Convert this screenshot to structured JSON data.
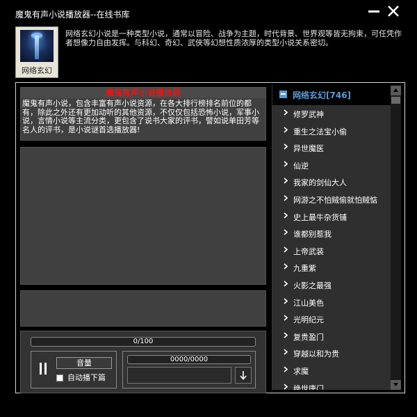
{
  "window": {
    "title": "魔鬼有声小说播放器--在线书库"
  },
  "header": {
    "category_caption": "网络玄幻",
    "description": "网络玄幻小说是一种类型小说，通常以冒险、战争为主题，时代背景、世界观等皆无拘束，可任凭作者想像力自由发挥。与科幻、奇幻、武侠等幻想性质浓厚的类型小说关系密切。"
  },
  "announcement": {
    "title": "魔鬼有声小说播放器",
    "text": "魔鬼有声小说，包含丰富有声小说资源，在各大排行榜排名前位的都有，除此之外还有更加动听的其他资源，不仅仅包括恐怖小说，军事小说，言情小说等主流分类，更包含了说书大家的评书，譬如说单田芳等名人的评书，是小说谜首选播放器!"
  },
  "controls": {
    "main_progress": {
      "value": 0,
      "max": 100,
      "text": "0/100"
    },
    "volume_label": "音量",
    "auto_next_label": "自动播下篇",
    "auto_next_checked": false,
    "download_progress_text": "0000/0000"
  },
  "tree": {
    "root": {
      "label": "网络玄幻",
      "count": "[746]"
    },
    "items": [
      "修罗武神",
      "重生之法宝小偷",
      "异世魔医",
      "仙逆",
      "我家的剑仙大人",
      "网游之不怕贼偷就怕贼惦",
      "史上最牛杂货铺",
      "谁都别惹我",
      "上帝武装",
      "九重紫",
      "火影之最强",
      "江山美色",
      "光明纪元",
      "复贵盈门",
      "穿越以和为贵",
      "求魔",
      "绝世唐门"
    ]
  },
  "colors": {
    "background": "#000000",
    "panel": "#404040",
    "announcement_title": "#e01818",
    "tree_root": "#5b9bd5",
    "tree_list_bg": "#2f2f2f"
  }
}
